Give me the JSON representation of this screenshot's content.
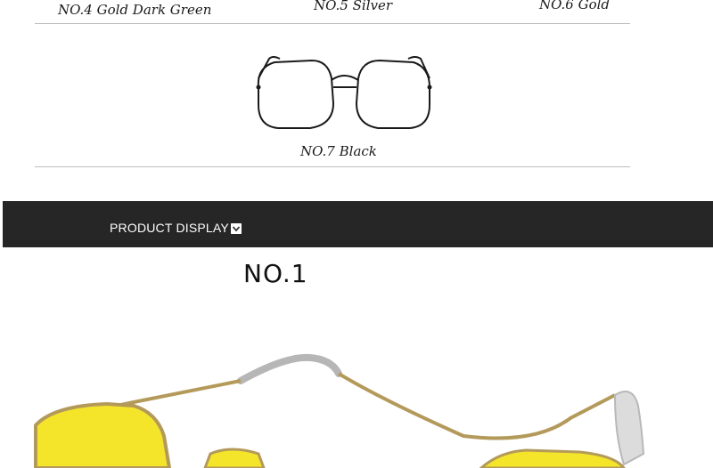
{
  "variants": {
    "no4": "NO.4 Gold Dark Green",
    "no5": "NO.5 Silver",
    "no6": "NO.6 Gold",
    "no7": "NO.7 Black"
  },
  "display_bar": {
    "label": "PRODUCT DISPLAY",
    "icon": "chevron-down-icon"
  },
  "product_display": {
    "heading": "NO.1"
  },
  "colors": {
    "bar": "#262626",
    "lens": "#f4e52b",
    "frame_gold": "#b49a5a"
  }
}
